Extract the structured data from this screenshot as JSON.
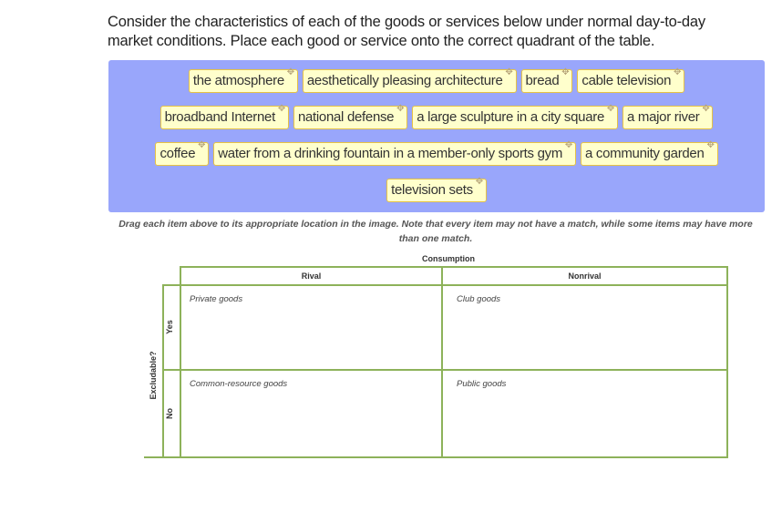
{
  "prompt": "Consider the characteristics of each of the goods or services below under normal day-to-day market conditions. Place each good or service onto the correct quadrant of the table.",
  "drag_handle_icon": "✥",
  "item_bank": {
    "rows": [
      [
        "the atmosphere",
        "aesthetically pleasing architecture",
        "bread",
        "cable television"
      ],
      [
        "broadband Internet",
        "national defense",
        "a large sculpture in a city square",
        "a major river"
      ],
      [
        "coffee",
        "water from a drinking fountain in a member-only sports gym",
        "a community garden"
      ],
      [
        "television sets"
      ]
    ],
    "background_color": "#99a6fb",
    "tile_color": "#ffffcc",
    "tile_border_color": "#e6c244"
  },
  "instructions": "Drag each item above to its appropriate location in the image. Note that every item may not have a match, while some items may have more than one match.",
  "table": {
    "column_axis_label": "Consumption",
    "row_axis_label": "Excludable?",
    "columns": [
      "Rival",
      "Nonrival"
    ],
    "rows": [
      "Yes",
      "No"
    ],
    "cells": {
      "yes_rival": "Private goods",
      "yes_nonrival": "Club goods",
      "no_rival": "Common-resource goods",
      "no_nonrival": "Public goods"
    },
    "line_color": "#8db25a"
  }
}
